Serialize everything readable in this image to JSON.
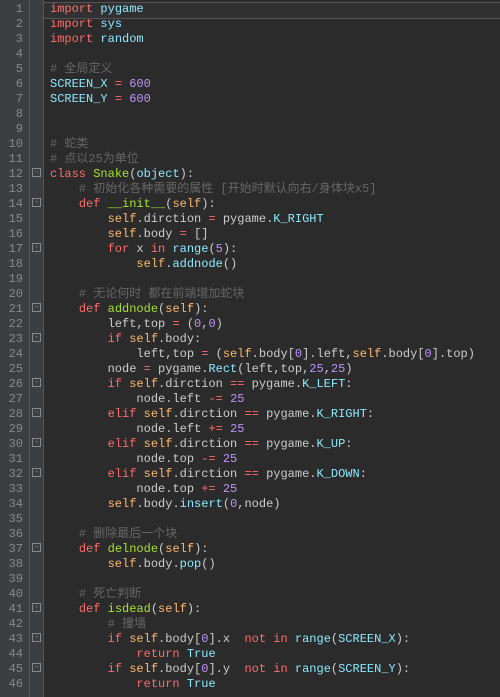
{
  "lines": [
    {
      "n": 1,
      "fold": "",
      "tokens": [
        [
          "kw",
          "import"
        ],
        [
          null,
          " "
        ],
        [
          "builtin",
          "pygame"
        ]
      ]
    },
    {
      "n": 2,
      "fold": "",
      "tokens": [
        [
          "kw",
          "import"
        ],
        [
          null,
          " "
        ],
        [
          "builtin",
          "sys"
        ]
      ]
    },
    {
      "n": 3,
      "fold": "",
      "tokens": [
        [
          "kw",
          "import"
        ],
        [
          null,
          " "
        ],
        [
          "builtin",
          "random"
        ]
      ]
    },
    {
      "n": 4,
      "fold": "",
      "tokens": []
    },
    {
      "n": 5,
      "fold": "",
      "tokens": [
        [
          "cmt",
          "# 全局定义"
        ]
      ]
    },
    {
      "n": 6,
      "fold": "",
      "tokens": [
        [
          "const",
          "SCREEN_X"
        ],
        [
          null,
          " "
        ],
        [
          "op",
          "="
        ],
        [
          null,
          " "
        ],
        [
          "num",
          "600"
        ]
      ]
    },
    {
      "n": 7,
      "fold": "",
      "tokens": [
        [
          "const",
          "SCREEN_Y"
        ],
        [
          null,
          " "
        ],
        [
          "op",
          "="
        ],
        [
          null,
          " "
        ],
        [
          "num",
          "600"
        ]
      ]
    },
    {
      "n": 8,
      "fold": "",
      "tokens": []
    },
    {
      "n": 9,
      "fold": "",
      "tokens": []
    },
    {
      "n": 10,
      "fold": "",
      "tokens": [
        [
          "cmt",
          "# 蛇类"
        ]
      ]
    },
    {
      "n": 11,
      "fold": "",
      "tokens": [
        [
          "cmt",
          "# 点以25为单位"
        ]
      ]
    },
    {
      "n": 12,
      "fold": "-",
      "tokens": [
        [
          "kw-def",
          "class"
        ],
        [
          null,
          " "
        ],
        [
          "cls",
          "Snake"
        ],
        [
          "pn",
          "("
        ],
        [
          "builtin",
          "object"
        ],
        [
          "pn",
          "):"
        ]
      ]
    },
    {
      "n": 13,
      "fold": "",
      "indent": 1,
      "tokens": [
        [
          "cmt",
          "# 初始化各种需要的属性 [开始时默认向右/身体块x5]"
        ]
      ]
    },
    {
      "n": 14,
      "fold": "-",
      "indent": 1,
      "tokens": [
        [
          "kw-def",
          "def"
        ],
        [
          null,
          " "
        ],
        [
          "fn",
          "__init__"
        ],
        [
          "pn",
          "("
        ],
        [
          "self",
          "self"
        ],
        [
          "pn",
          "):"
        ]
      ]
    },
    {
      "n": 15,
      "fold": "",
      "indent": 2,
      "tokens": [
        [
          "self",
          "self"
        ],
        [
          "pn",
          "."
        ],
        [
          "attr",
          "dirction"
        ],
        [
          null,
          " "
        ],
        [
          "op",
          "="
        ],
        [
          null,
          " "
        ],
        [
          "attr",
          "pygame"
        ],
        [
          "pn",
          "."
        ],
        [
          "const",
          "K_RIGHT"
        ]
      ]
    },
    {
      "n": 16,
      "fold": "",
      "indent": 2,
      "tokens": [
        [
          "self",
          "self"
        ],
        [
          "pn",
          "."
        ],
        [
          "attr",
          "body"
        ],
        [
          null,
          " "
        ],
        [
          "op",
          "="
        ],
        [
          null,
          " "
        ],
        [
          "pn",
          "[]"
        ]
      ]
    },
    {
      "n": 17,
      "fold": "-",
      "indent": 2,
      "tokens": [
        [
          "kw",
          "for"
        ],
        [
          null,
          " "
        ],
        [
          "attr",
          "x"
        ],
        [
          null,
          " "
        ],
        [
          "kw",
          "in"
        ],
        [
          null,
          " "
        ],
        [
          "fn-call",
          "range"
        ],
        [
          "pn",
          "("
        ],
        [
          "num",
          "5"
        ],
        [
          "pn",
          "):"
        ]
      ]
    },
    {
      "n": 18,
      "fold": "",
      "indent": 3,
      "tokens": [
        [
          "self",
          "self"
        ],
        [
          "pn",
          "."
        ],
        [
          "fn-call",
          "addnode"
        ],
        [
          "pn",
          "()"
        ]
      ]
    },
    {
      "n": 19,
      "fold": "",
      "tokens": []
    },
    {
      "n": 20,
      "fold": "",
      "indent": 1,
      "tokens": [
        [
          "cmt",
          "# 无论何时 都在前端增加蛇块"
        ]
      ]
    },
    {
      "n": 21,
      "fold": "-",
      "indent": 1,
      "tokens": [
        [
          "kw-def",
          "def"
        ],
        [
          null,
          " "
        ],
        [
          "fn",
          "addnode"
        ],
        [
          "pn",
          "("
        ],
        [
          "self",
          "self"
        ],
        [
          "pn",
          "):"
        ]
      ]
    },
    {
      "n": 22,
      "fold": "",
      "indent": 2,
      "tokens": [
        [
          "attr",
          "left"
        ],
        [
          "pn",
          ","
        ],
        [
          "attr",
          "top"
        ],
        [
          null,
          " "
        ],
        [
          "op",
          "="
        ],
        [
          null,
          " "
        ],
        [
          "pn",
          "("
        ],
        [
          "num",
          "0"
        ],
        [
          "pn",
          ","
        ],
        [
          "num",
          "0"
        ],
        [
          "pn",
          ")"
        ]
      ]
    },
    {
      "n": 23,
      "fold": "-",
      "indent": 2,
      "tokens": [
        [
          "kw",
          "if"
        ],
        [
          null,
          " "
        ],
        [
          "self",
          "self"
        ],
        [
          "pn",
          "."
        ],
        [
          "attr",
          "body"
        ],
        [
          "pn",
          ":"
        ]
      ]
    },
    {
      "n": 24,
      "fold": "",
      "indent": 3,
      "tokens": [
        [
          "attr",
          "left"
        ],
        [
          "pn",
          ","
        ],
        [
          "attr",
          "top"
        ],
        [
          null,
          " "
        ],
        [
          "op",
          "="
        ],
        [
          null,
          " "
        ],
        [
          "pn",
          "("
        ],
        [
          "self",
          "self"
        ],
        [
          "pn",
          "."
        ],
        [
          "attr",
          "body"
        ],
        [
          "pn",
          "["
        ],
        [
          "num",
          "0"
        ],
        [
          "pn",
          "]."
        ],
        [
          "attr",
          "left"
        ],
        [
          "pn",
          ","
        ],
        [
          "self",
          "self"
        ],
        [
          "pn",
          "."
        ],
        [
          "attr",
          "body"
        ],
        [
          "pn",
          "["
        ],
        [
          "num",
          "0"
        ],
        [
          "pn",
          "]."
        ],
        [
          "attr",
          "top"
        ],
        [
          "pn",
          ")"
        ]
      ]
    },
    {
      "n": 25,
      "fold": "",
      "indent": 2,
      "tokens": [
        [
          "attr",
          "node"
        ],
        [
          null,
          " "
        ],
        [
          "op",
          "="
        ],
        [
          null,
          " "
        ],
        [
          "attr",
          "pygame"
        ],
        [
          "pn",
          "."
        ],
        [
          "fn-call",
          "Rect"
        ],
        [
          "pn",
          "("
        ],
        [
          "attr",
          "left"
        ],
        [
          "pn",
          ","
        ],
        [
          "attr",
          "top"
        ],
        [
          "pn",
          ","
        ],
        [
          "num",
          "25"
        ],
        [
          "pn",
          ","
        ],
        [
          "num",
          "25"
        ],
        [
          "pn",
          ")"
        ]
      ]
    },
    {
      "n": 26,
      "fold": "-",
      "indent": 2,
      "tokens": [
        [
          "kw",
          "if"
        ],
        [
          null,
          " "
        ],
        [
          "self",
          "self"
        ],
        [
          "pn",
          "."
        ],
        [
          "attr",
          "dirction"
        ],
        [
          null,
          " "
        ],
        [
          "op",
          "=="
        ],
        [
          null,
          " "
        ],
        [
          "attr",
          "pygame"
        ],
        [
          "pn",
          "."
        ],
        [
          "const",
          "K_LEFT"
        ],
        [
          "pn",
          ":"
        ]
      ]
    },
    {
      "n": 27,
      "fold": "",
      "indent": 3,
      "tokens": [
        [
          "attr",
          "node"
        ],
        [
          "pn",
          "."
        ],
        [
          "attr",
          "left"
        ],
        [
          null,
          " "
        ],
        [
          "op",
          "-="
        ],
        [
          null,
          " "
        ],
        [
          "num",
          "25"
        ]
      ]
    },
    {
      "n": 28,
      "fold": "-",
      "indent": 2,
      "tokens": [
        [
          "kw",
          "elif"
        ],
        [
          null,
          " "
        ],
        [
          "self",
          "self"
        ],
        [
          "pn",
          "."
        ],
        [
          "attr",
          "dirction"
        ],
        [
          null,
          " "
        ],
        [
          "op",
          "=="
        ],
        [
          null,
          " "
        ],
        [
          "attr",
          "pygame"
        ],
        [
          "pn",
          "."
        ],
        [
          "const",
          "K_RIGHT"
        ],
        [
          "pn",
          ":"
        ]
      ]
    },
    {
      "n": 29,
      "fold": "",
      "indent": 3,
      "tokens": [
        [
          "attr",
          "node"
        ],
        [
          "pn",
          "."
        ],
        [
          "attr",
          "left"
        ],
        [
          null,
          " "
        ],
        [
          "op",
          "+="
        ],
        [
          null,
          " "
        ],
        [
          "num",
          "25"
        ]
      ]
    },
    {
      "n": 30,
      "fold": "-",
      "indent": 2,
      "tokens": [
        [
          "kw",
          "elif"
        ],
        [
          null,
          " "
        ],
        [
          "self",
          "self"
        ],
        [
          "pn",
          "."
        ],
        [
          "attr",
          "dirction"
        ],
        [
          null,
          " "
        ],
        [
          "op",
          "=="
        ],
        [
          null,
          " "
        ],
        [
          "attr",
          "pygame"
        ],
        [
          "pn",
          "."
        ],
        [
          "const",
          "K_UP"
        ],
        [
          "pn",
          ":"
        ]
      ]
    },
    {
      "n": 31,
      "fold": "",
      "indent": 3,
      "tokens": [
        [
          "attr",
          "node"
        ],
        [
          "pn",
          "."
        ],
        [
          "attr",
          "top"
        ],
        [
          null,
          " "
        ],
        [
          "op",
          "-="
        ],
        [
          null,
          " "
        ],
        [
          "num",
          "25"
        ]
      ]
    },
    {
      "n": 32,
      "fold": "-",
      "indent": 2,
      "tokens": [
        [
          "kw",
          "elif"
        ],
        [
          null,
          " "
        ],
        [
          "self",
          "self"
        ],
        [
          "pn",
          "."
        ],
        [
          "attr",
          "dirction"
        ],
        [
          null,
          " "
        ],
        [
          "op",
          "=="
        ],
        [
          null,
          " "
        ],
        [
          "attr",
          "pygame"
        ],
        [
          "pn",
          "."
        ],
        [
          "const",
          "K_DOWN"
        ],
        [
          "pn",
          ":"
        ]
      ]
    },
    {
      "n": 33,
      "fold": "",
      "indent": 3,
      "tokens": [
        [
          "attr",
          "node"
        ],
        [
          "pn",
          "."
        ],
        [
          "attr",
          "top"
        ],
        [
          null,
          " "
        ],
        [
          "op",
          "+="
        ],
        [
          null,
          " "
        ],
        [
          "num",
          "25"
        ]
      ]
    },
    {
      "n": 34,
      "fold": "",
      "indent": 2,
      "tokens": [
        [
          "self",
          "self"
        ],
        [
          "pn",
          "."
        ],
        [
          "attr",
          "body"
        ],
        [
          "pn",
          "."
        ],
        [
          "fn-call",
          "insert"
        ],
        [
          "pn",
          "("
        ],
        [
          "num",
          "0"
        ],
        [
          "pn",
          ","
        ],
        [
          "attr",
          "node"
        ],
        [
          "pn",
          ")"
        ]
      ]
    },
    {
      "n": 35,
      "fold": "",
      "tokens": []
    },
    {
      "n": 36,
      "fold": "",
      "indent": 1,
      "tokens": [
        [
          "cmt",
          "# 删除最后一个块"
        ]
      ]
    },
    {
      "n": 37,
      "fold": "-",
      "indent": 1,
      "tokens": [
        [
          "kw-def",
          "def"
        ],
        [
          null,
          " "
        ],
        [
          "fn",
          "delnode"
        ],
        [
          "pn",
          "("
        ],
        [
          "self",
          "self"
        ],
        [
          "pn",
          "):"
        ]
      ]
    },
    {
      "n": 38,
      "fold": "",
      "indent": 2,
      "tokens": [
        [
          "self",
          "self"
        ],
        [
          "pn",
          "."
        ],
        [
          "attr",
          "body"
        ],
        [
          "pn",
          "."
        ],
        [
          "fn-call",
          "pop"
        ],
        [
          "pn",
          "()"
        ]
      ]
    },
    {
      "n": 39,
      "fold": "",
      "tokens": []
    },
    {
      "n": 40,
      "fold": "",
      "indent": 1,
      "tokens": [
        [
          "cmt",
          "# 死亡判断"
        ]
      ]
    },
    {
      "n": 41,
      "fold": "-",
      "indent": 1,
      "tokens": [
        [
          "kw-def",
          "def"
        ],
        [
          null,
          " "
        ],
        [
          "fn",
          "isdead"
        ],
        [
          "pn",
          "("
        ],
        [
          "self",
          "self"
        ],
        [
          "pn",
          "):"
        ]
      ]
    },
    {
      "n": 42,
      "fold": "",
      "indent": 2,
      "tokens": [
        [
          "cmt",
          "# 撞墙"
        ]
      ]
    },
    {
      "n": 43,
      "fold": "-",
      "indent": 2,
      "tokens": [
        [
          "kw",
          "if"
        ],
        [
          null,
          " "
        ],
        [
          "self",
          "self"
        ],
        [
          "pn",
          "."
        ],
        [
          "attr",
          "body"
        ],
        [
          "pn",
          "["
        ],
        [
          "num",
          "0"
        ],
        [
          "pn",
          "]."
        ],
        [
          "attr",
          "x"
        ],
        [
          null,
          "  "
        ],
        [
          "kw",
          "not"
        ],
        [
          null,
          " "
        ],
        [
          "kw",
          "in"
        ],
        [
          null,
          " "
        ],
        [
          "fn-call",
          "range"
        ],
        [
          "pn",
          "("
        ],
        [
          "const",
          "SCREEN_X"
        ],
        [
          "pn",
          "):"
        ]
      ]
    },
    {
      "n": 44,
      "fold": "",
      "indent": 3,
      "tokens": [
        [
          "kw",
          "return"
        ],
        [
          null,
          " "
        ],
        [
          "const",
          "True"
        ]
      ]
    },
    {
      "n": 45,
      "fold": "-",
      "indent": 2,
      "tokens": [
        [
          "kw",
          "if"
        ],
        [
          null,
          " "
        ],
        [
          "self",
          "self"
        ],
        [
          "pn",
          "."
        ],
        [
          "attr",
          "body"
        ],
        [
          "pn",
          "["
        ],
        [
          "num",
          "0"
        ],
        [
          "pn",
          "]."
        ],
        [
          "attr",
          "y"
        ],
        [
          null,
          "  "
        ],
        [
          "kw",
          "not"
        ],
        [
          null,
          " "
        ],
        [
          "kw",
          "in"
        ],
        [
          null,
          " "
        ],
        [
          "fn-call",
          "range"
        ],
        [
          "pn",
          "("
        ],
        [
          "const",
          "SCREEN_Y"
        ],
        [
          "pn",
          "):"
        ]
      ]
    },
    {
      "n": 46,
      "fold": "",
      "indent": 3,
      "tokens": [
        [
          "kw",
          "return"
        ],
        [
          null,
          " "
        ],
        [
          "const",
          "True"
        ]
      ]
    }
  ],
  "indent_unit": "    "
}
